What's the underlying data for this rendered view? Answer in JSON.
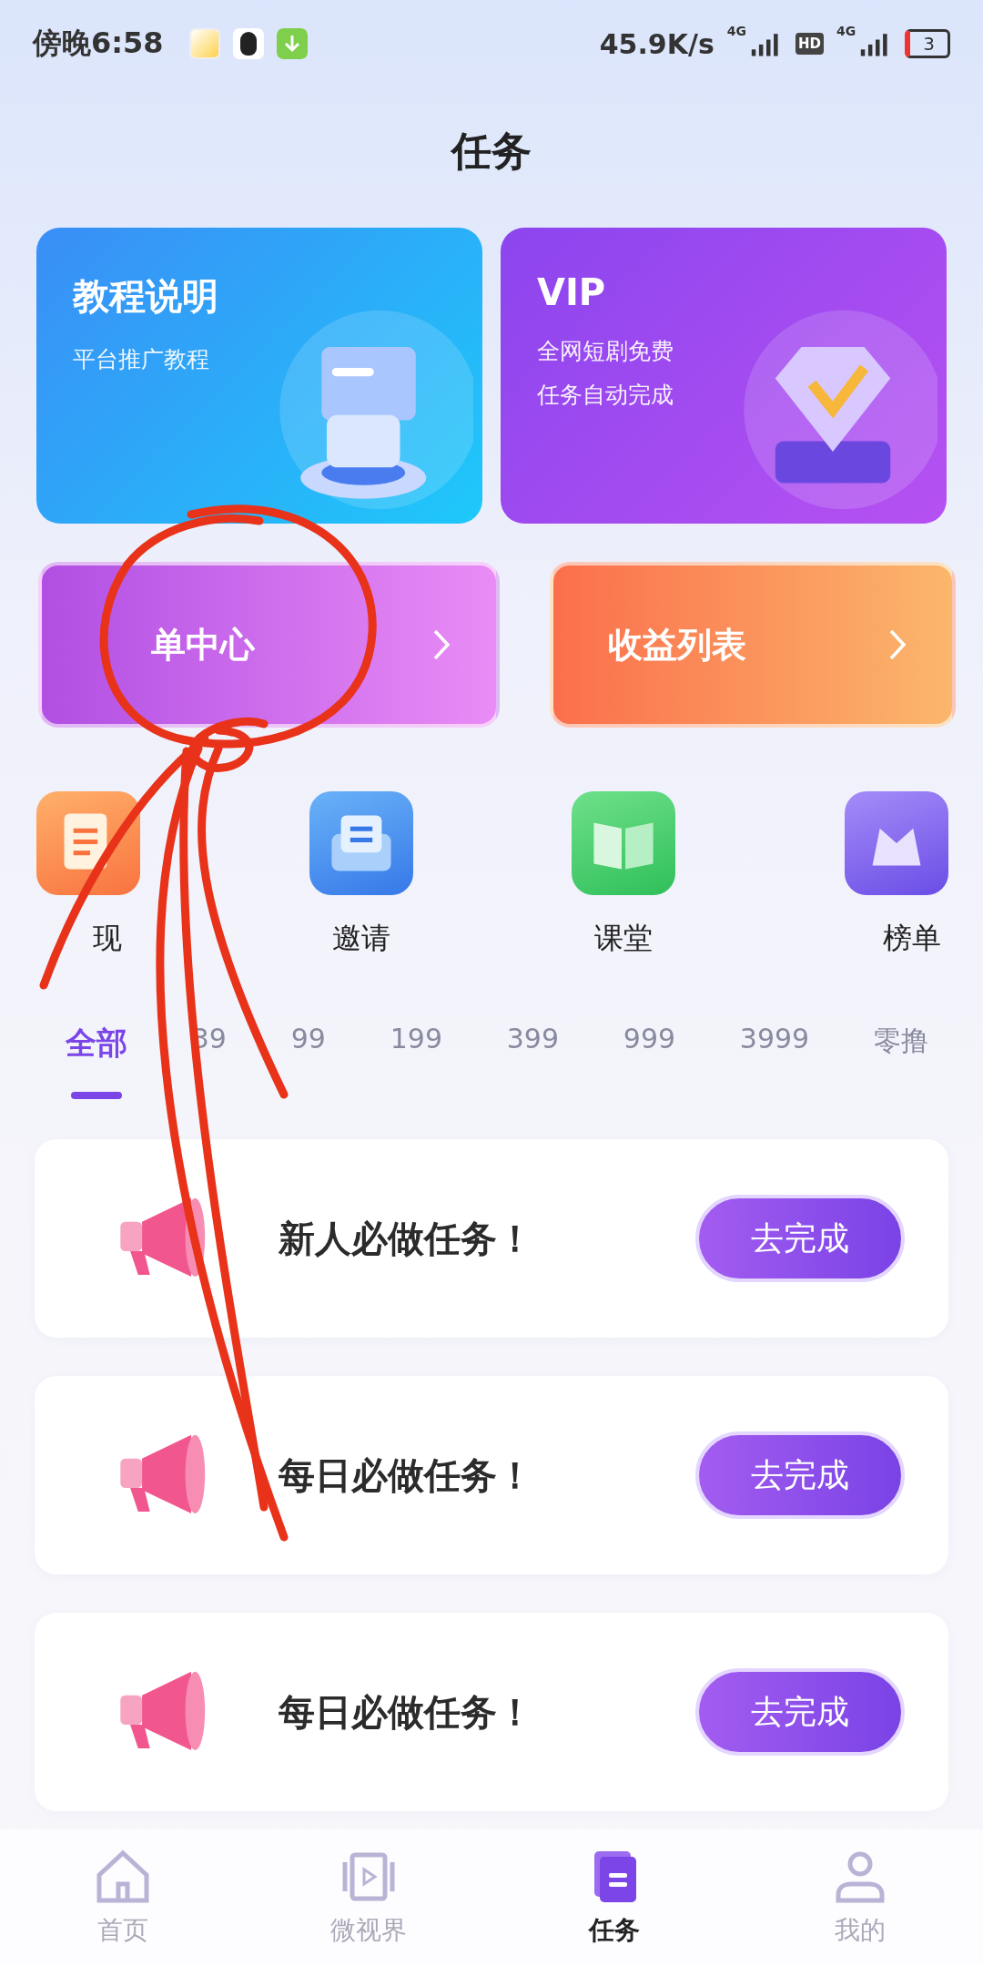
{
  "status_bar": {
    "time": "傍晚6:58",
    "speed": "45.9K/s",
    "network_1": "4G",
    "hd": "HD",
    "network_2": "4G",
    "battery": "3"
  },
  "title": "任务",
  "promo_cards": [
    {
      "kind": "tutorial",
      "title": "教程说明",
      "lines": [
        "平台推广教程"
      ]
    },
    {
      "kind": "vip",
      "title": "VIP",
      "lines": [
        "全网短剧免费",
        "任务自动完成"
      ]
    }
  ],
  "link_cards": [
    {
      "kind": "orders",
      "label": "单中心"
    },
    {
      "kind": "income",
      "label": "收益列表"
    }
  ],
  "shortcuts": [
    {
      "kind": "cash",
      "label": "现"
    },
    {
      "kind": "invite",
      "label": "邀请"
    },
    {
      "kind": "class",
      "label": "课堂"
    },
    {
      "kind": "rank",
      "label": "榜单"
    }
  ],
  "filter_tabs": [
    {
      "label": "全部",
      "selected": true
    },
    {
      "label": "39",
      "selected": false
    },
    {
      "label": "99",
      "selected": false
    },
    {
      "label": "199",
      "selected": false
    },
    {
      "label": "399",
      "selected": false
    },
    {
      "label": "999",
      "selected": false
    },
    {
      "label": "3999",
      "selected": false
    },
    {
      "label": "零撸",
      "selected": false
    }
  ],
  "tasks": [
    {
      "title": "新人必做任务！",
      "button": "去完成"
    },
    {
      "title": "每日必做任务！",
      "button": "去完成"
    },
    {
      "title": "每日必做任务！",
      "button": "去完成"
    }
  ],
  "bottom_nav": [
    {
      "kind": "home",
      "label": "首页",
      "selected": false
    },
    {
      "kind": "video",
      "label": "微视界",
      "selected": false
    },
    {
      "kind": "tasks",
      "label": "任务",
      "selected": true
    },
    {
      "kind": "profile",
      "label": "我的",
      "selected": false
    }
  ]
}
